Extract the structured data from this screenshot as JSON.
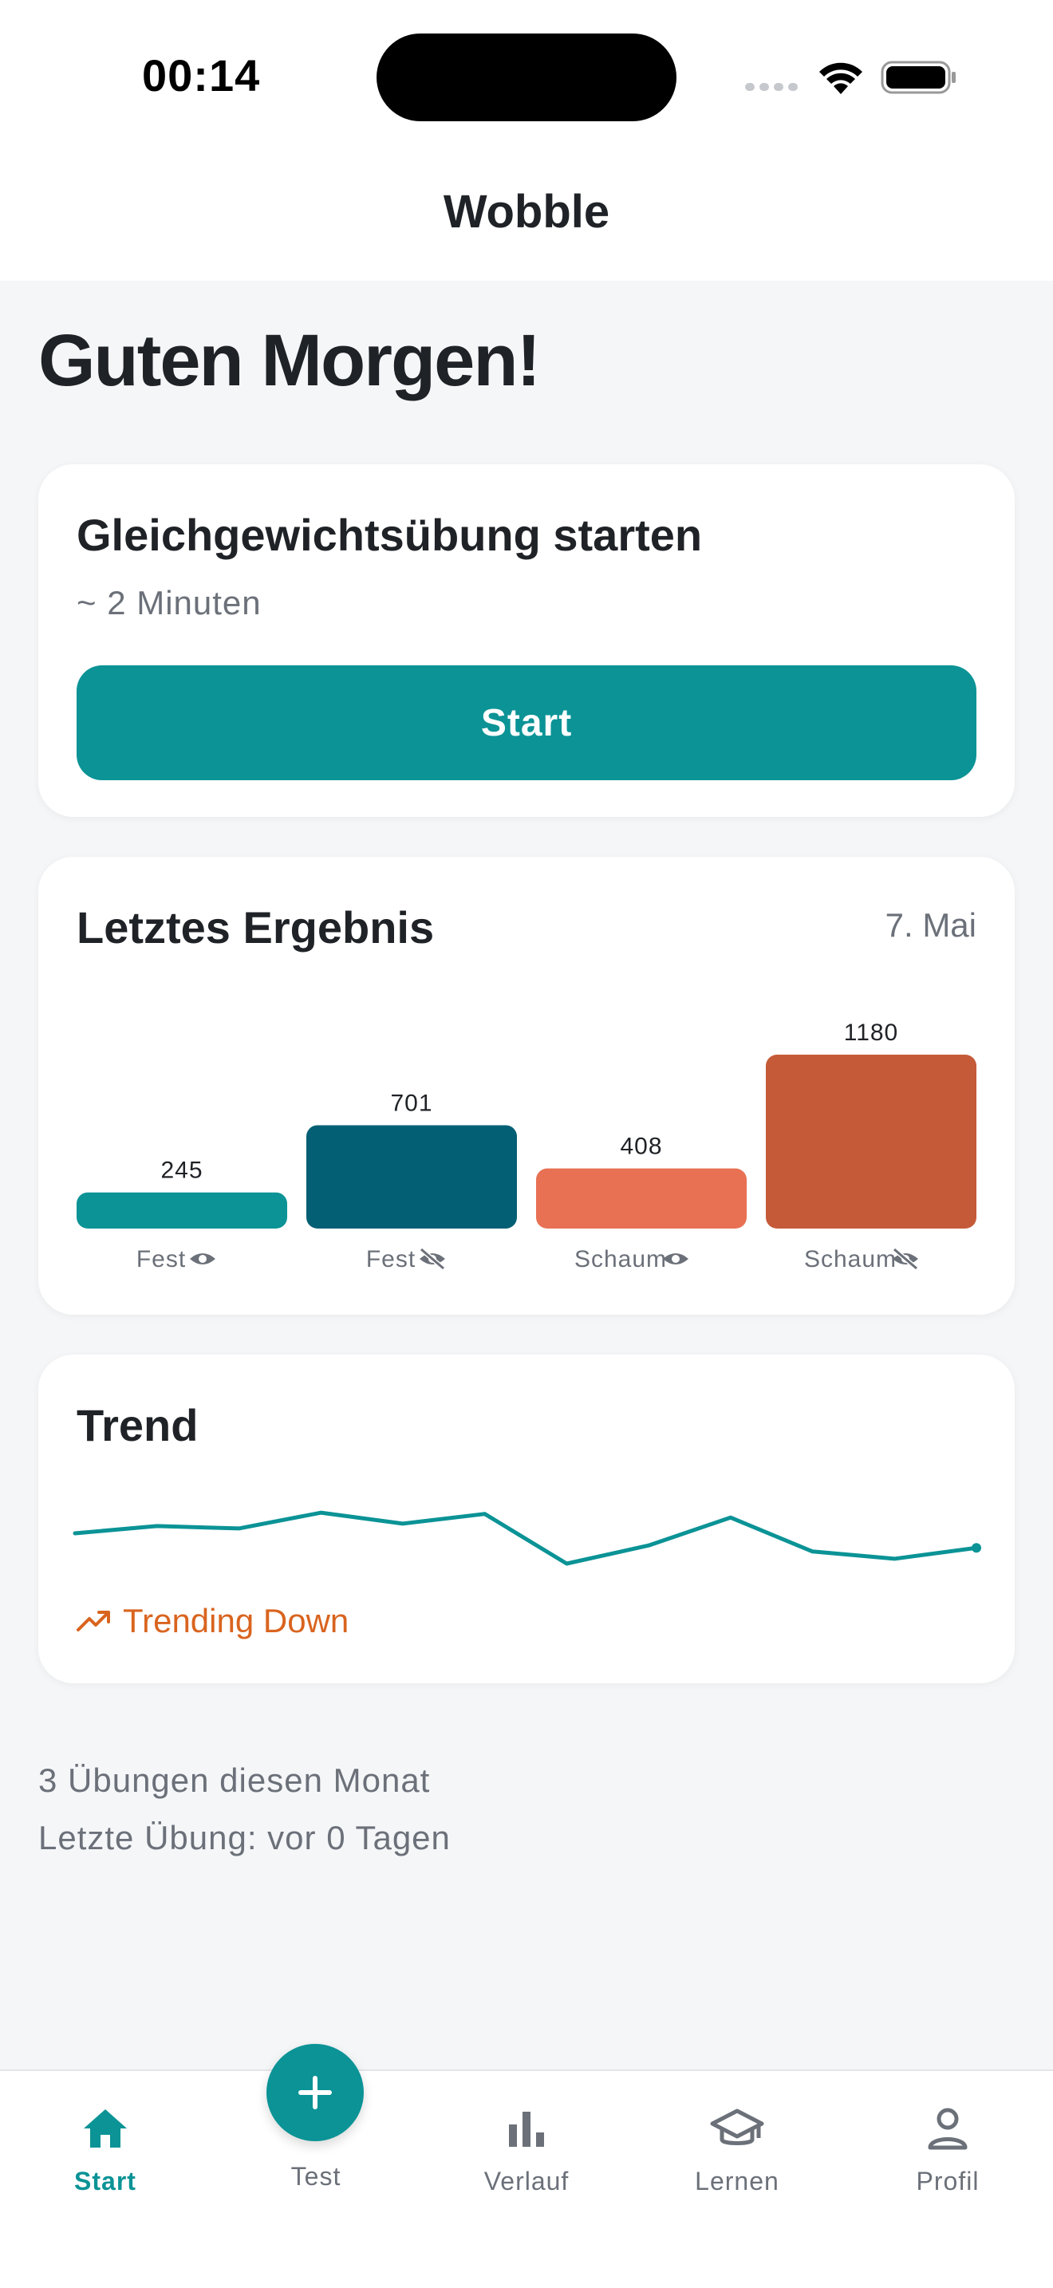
{
  "status_bar": {
    "time": "00:14"
  },
  "header": {
    "title": "Wobble"
  },
  "greeting": "Guten Morgen!",
  "start_card": {
    "title": "Gleichgewichtsübung starten",
    "duration": "~ 2 Minuten",
    "button_label": "Start"
  },
  "result_card": {
    "title": "Letztes Ergebnis",
    "date": "7. Mai"
  },
  "chart_data": {
    "type": "bar",
    "categories": [
      "Fest",
      "Fest",
      "Schaum",
      "Schaum"
    ],
    "category_icons": [
      "eye-icon",
      "eye-off-icon",
      "eye-icon",
      "eye-off-icon"
    ],
    "values": [
      245,
      701,
      408,
      1180
    ],
    "colors": [
      "#0b9396",
      "#035f74",
      "#e87053",
      "#c55a38"
    ],
    "title": "Letztes Ergebnis",
    "xlabel": "",
    "ylabel": "",
    "ylim": [
      0,
      1180
    ]
  },
  "trend_card": {
    "title": "Trend",
    "status": "Trending Down",
    "status_color": "#d9641f",
    "line_color": "#0b9396",
    "points": [
      0.5,
      0.62,
      0.58,
      0.84,
      0.66,
      0.82,
      0.0,
      0.3,
      0.76,
      0.2,
      0.08,
      0.26
    ]
  },
  "stats": {
    "month_count": "3 Übungen diesen Monat",
    "last_exercise": "Letzte Übung: vor 0 Tagen"
  },
  "tabs": [
    {
      "label": "Start",
      "icon": "home-icon",
      "active": true
    },
    {
      "label": "Test",
      "icon": "plus-icon",
      "active": false
    },
    {
      "label": "Verlauf",
      "icon": "bar-chart-icon",
      "active": false
    },
    {
      "label": "Lernen",
      "icon": "graduation-cap-icon",
      "active": false
    },
    {
      "label": "Profil",
      "icon": "person-icon",
      "active": false
    }
  ],
  "colors": {
    "accent": "#0b9396",
    "background": "#f5f6f8",
    "trend_down": "#d9641f"
  }
}
